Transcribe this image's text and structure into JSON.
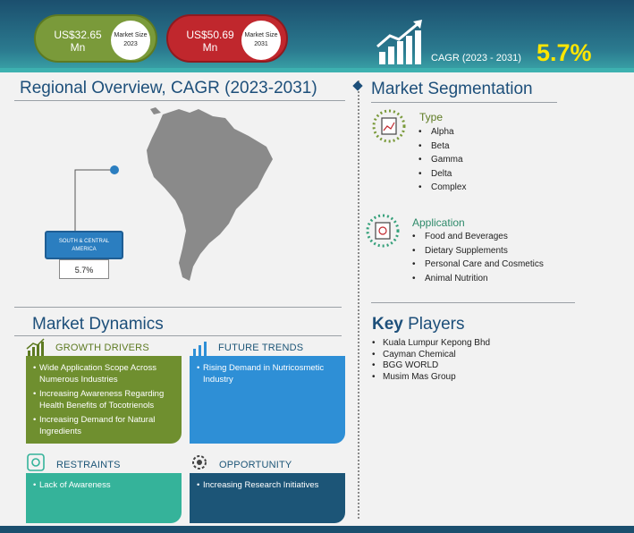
{
  "header": {
    "market_size_2023": {
      "value": "US$32.65 Mn",
      "label": "Market Size 2023"
    },
    "market_size_2031": {
      "value": "US$50.69 Mn",
      "label": "Market Size 2031"
    },
    "cagr_label": "CAGR (2023 - 2031)",
    "cagr_value": "5.7%"
  },
  "regional": {
    "title": "Regional Overview, CAGR (2023-2031)",
    "region_name": "SOUTH & CENTRAL AMERICA",
    "region_cagr": "5.7%"
  },
  "segmentation": {
    "title": "Market Segmentation",
    "type": {
      "heading": "Type",
      "items": [
        "Alpha",
        "Beta",
        "Gamma",
        "Delta",
        "Complex"
      ]
    },
    "application": {
      "heading": "Application",
      "items": [
        "Food and Beverages",
        "Dietary Supplements",
        "Personal Care and Cosmetics",
        "Animal Nutrition"
      ]
    }
  },
  "dynamics": {
    "title": "Market Dynamics",
    "growth_drivers": {
      "heading": "GROWTH DRIVERS",
      "items": [
        "Wide Application Scope Across Numerous Industries",
        "Increasing Awareness Regarding Health Benefits of Tocotrienols",
        "Increasing Demand for Natural Ingredients"
      ]
    },
    "future_trends": {
      "heading": "FUTURE TRENDS",
      "items": [
        "Rising Demand in Nutricosmetic Industry"
      ]
    },
    "restraints": {
      "heading": "RESTRAINTS",
      "items": [
        "Lack of Awareness"
      ]
    },
    "opportunity": {
      "heading": "OPPORTUNITY",
      "items": [
        "Increasing Research Initiatives"
      ]
    }
  },
  "key_players": {
    "title_bold": "Key",
    "title_rest": " Players",
    "items": [
      "Kuala Lumpur Kepong Bhd",
      "Cayman Chemical",
      "BGG WORLD",
      "Musim Mas Group"
    ]
  },
  "colors": {
    "header": "#1b4f6e",
    "green": "#7a9a3a",
    "red": "#c0272d",
    "accent_yellow": "#ffe600",
    "title_blue": "#1d4f7a",
    "drivers": "#6f8f2f",
    "trends": "#2e8fd6",
    "restraints": "#35b39a",
    "opportunity": "#1c5577"
  },
  "icons": [
    "growth-chart-icon",
    "type-icon",
    "application-icon",
    "drivers-icon",
    "trends-icon",
    "restraints-icon",
    "opportunity-icon",
    "map-pin-icon"
  ]
}
